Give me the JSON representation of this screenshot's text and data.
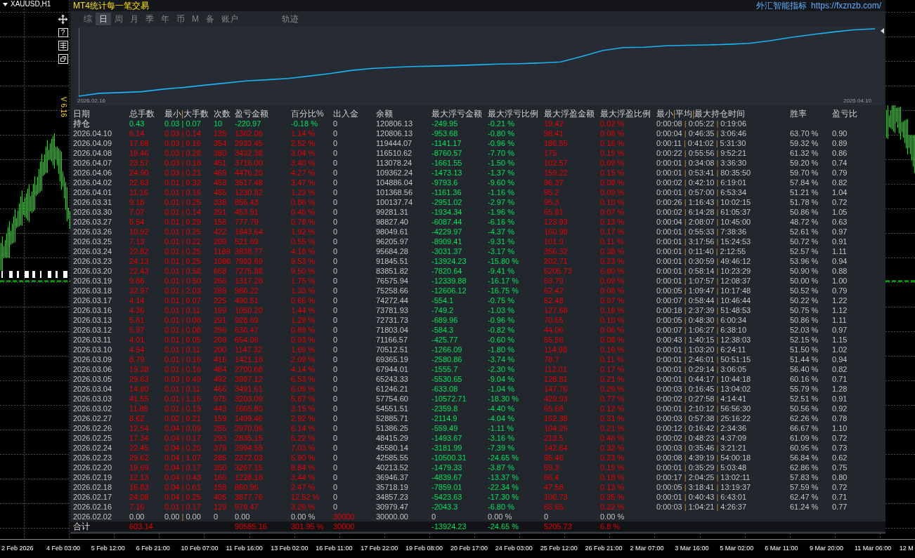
{
  "chart_window": {
    "symbol": "XAUUSD,H1",
    "version": "V 6.16",
    "tools": [
      {
        "kind": "move"
      },
      {
        "kind": "help",
        "label": "?"
      },
      {
        "kind": "table"
      },
      {
        "kind": "window"
      }
    ],
    "time_axis": [
      "2 Feb 2026",
      "4 Feb 03:00",
      "5 Feb 12:00",
      "6 Feb 21:00",
      "10 Feb 07:00",
      "11 Feb 16:00",
      "13 Feb 02:00",
      "16 Feb 11:00",
      "17 Feb 22:00",
      "19 Feb 08:00",
      "20 Feb 17:00",
      "24 Feb 03:00",
      "25 Feb 12:00",
      "26 Feb 21:00",
      "2 Mar 07:00",
      "3 Mar 16:00",
      "5 Mar 02:00",
      "6 Mar 11:00",
      "9 Mar 20:00",
      "11 Mar 06:00",
      "12 M"
    ]
  },
  "panel": {
    "title": "MT4统计每一笔交易",
    "brand": "外汇智能指标",
    "link": "https://fxznzb.com/",
    "tab_groups": [
      [
        {
          "label": "综",
          "selected": false
        },
        {
          "label": "日",
          "selected": true
        },
        {
          "label": "周",
          "selected": false
        },
        {
          "label": "月",
          "selected": false
        },
        {
          "label": "季",
          "selected": false
        },
        {
          "label": "年",
          "selected": false
        },
        {
          "label": "币",
          "selected": false
        },
        {
          "label": "M",
          "selected": false
        },
        {
          "label": "备",
          "selected": false
        },
        {
          "label": "账户",
          "selected": false
        }
      ],
      [
        {
          "label": "轨迹",
          "selected": false
        }
      ]
    ],
    "equity_chart": {
      "start_label": "2026.02.16",
      "end_label": "2026.04.10"
    },
    "table": {
      "columns": [
        "日期",
        "总手数",
        "最小|大手数",
        "次数",
        "盈亏金额",
        "百分比%",
        "出入金",
        "余额",
        "最大浮亏金额",
        "最大浮亏比例",
        "最大浮盈金额",
        "最大浮盈比例",
        "最小|平均|最大持仓时间",
        "胜率",
        "盈亏比"
      ],
      "rows": [
        {
          "kind": "open",
          "loss": true,
          "cells": [
            "持仓",
            "0.43",
            "0.03 | 0.07",
            "10",
            "-220.97",
            "-0.18 %",
            "0",
            "120806.13",
            "-249.95",
            "-0.21 %",
            "19.42",
            "0.02 %",
            "0:00:08 | 0:05:22 | 0:19:06"
          ]
        },
        {
          "kind": "day",
          "loss": false,
          "cells": [
            "2026.04.10",
            "6.14",
            "0.03 | 0.14",
            "135",
            "1362.06",
            "1.14 %",
            "0",
            "120806.13",
            "-953.68",
            "-0.80 %",
            "98.41",
            "0.08 %",
            "0:00:04 | 0:46:35 | 3:06:46",
            "63.70 %",
            "0.90"
          ]
        },
        {
          "kind": "day",
          "loss": false,
          "cells": [
            "2026.04.09",
            "17.68",
            "0.03 | 0.16",
            "354",
            "2933.45",
            "2.52 %",
            "0",
            "119444.07",
            "-1141.17",
            "-0.96 %",
            "186.55",
            "0.16 %",
            "0:00:11 | 0:41:02 | 5:31:30",
            "59.32 %",
            "0.89"
          ]
        },
        {
          "kind": "day",
          "loss": false,
          "cells": [
            "2026.04.08",
            "19.46",
            "0.03 | 0.28",
            "380",
            "3432.38",
            "3.04 %",
            "0",
            "116510.62",
            "-8760.57",
            "-7.70 %",
            "175",
            "0.15 %",
            "0:00:22 | 0:55:56 | 9:52:21",
            "61.32 %",
            "0.86"
          ]
        },
        {
          "kind": "day",
          "loss": false,
          "cells": [
            "2026.04.07",
            "23.57",
            "0.03 | 0.18",
            "451",
            "3716.00",
            "3.40 %",
            "0",
            "113078.24",
            "-1661.55",
            "-1.50 %",
            "102.57",
            "0.09 %",
            "0:00:01 | 0:34:08 | 3:36:30",
            "59.20 %",
            "0.74"
          ]
        },
        {
          "kind": "day",
          "loss": false,
          "cells": [
            "2026.04.06",
            "24.90",
            "0.03 | 0.21",
            "469",
            "4476.20",
            "4.27 %",
            "0",
            "109362.24",
            "-1473.13",
            "-1.37 %",
            "159.22",
            "0.15 %",
            "0:00:01 | 0:53:41 | 80:35:50",
            "59.70 %",
            "0.79"
          ]
        },
        {
          "kind": "day",
          "loss": false,
          "cells": [
            "2026.04.02",
            "22.63",
            "0.01 | 0.32",
            "453",
            "3517.48",
            "3.47 %",
            "0",
            "104886.04",
            "-9793.6",
            "-9.60 %",
            "96.37",
            "0.09 %",
            "0:00:02 | 0:42:10 | 6:19:01",
            "57.84 %",
            "0.82"
          ]
        },
        {
          "kind": "day",
          "loss": false,
          "cells": [
            "2026.04.01",
            "11.16",
            "0.01 | 0.16",
            "455",
            "1230.82",
            "1.23 %",
            "0",
            "101368.56",
            "-1161.36",
            "-1.16 %",
            "95.2",
            "0.09 %",
            "0:00:01 | 0:57:00 | 6:53:34",
            "51.21 %",
            "1.04"
          ]
        },
        {
          "kind": "day",
          "loss": false,
          "cells": [
            "2026.03.31",
            "9.18",
            "0.01 | 0.25",
            "338",
            "856.43",
            "0.86 %",
            "0",
            "100137.74",
            "-2951.02",
            "-2.97 %",
            "95.3",
            "0.10 %",
            "0:00:26 | 1:16:43 | 10:02:15",
            "51.78 %",
            "0.72"
          ]
        },
        {
          "kind": "day",
          "loss": false,
          "cells": [
            "2026.03.30",
            "7.07",
            "0.01 | 0.14",
            "291",
            "453.91",
            "0.46 %",
            "0",
            "99281.31",
            "-1934.34",
            "-1.96 %",
            "65.81",
            "0.07 %",
            "0:00:02 | 6:14:28 | 61:05:37",
            "50.86 %",
            "1.05"
          ]
        },
        {
          "kind": "day",
          "loss": false,
          "cells": [
            "2026.03.27",
            "5.54",
            "0.01 | 0.29",
            "156",
            "777.79",
            "0.79 %",
            "0",
            "98827.40",
            "-6087.44",
            "-6.16 %",
            "123.93",
            "0.13 %",
            "0:00:04 | 2:08:07 | 10:45:00",
            "48.72 %",
            "0.63"
          ]
        },
        {
          "kind": "day",
          "loss": false,
          "cells": [
            "2026.03.26",
            "10.92",
            "0.01 | 0.25",
            "422",
            "1843.64",
            "1.92 %",
            "0",
            "98049.61",
            "-4229.97",
            "-4.37 %",
            "160.98",
            "0.17 %",
            "0:00:01 | 0:55:33 | 7:38:36",
            "52.61 %",
            "0.97"
          ]
        },
        {
          "kind": "day",
          "loss": false,
          "cells": [
            "2026.03.25",
            "7.13",
            "0.01 | 0.22",
            "209",
            "521.69",
            "0.55 %",
            "0",
            "96205.97",
            "-8909.41",
            "-9.31 %",
            "101.9",
            "0.11 %",
            "0:00:01 | 3:17:56 | 15:24:53",
            "50.72 %",
            "0.91"
          ]
        },
        {
          "kind": "day",
          "loss": false,
          "cells": [
            "2026.03.24",
            "22.82",
            "0.01 | 0.25",
            "1189",
            "3838.77",
            "4.18 %",
            "0",
            "95684.28",
            "-3031.37",
            "-3.17 %",
            "356.32",
            "0.38 %",
            "0:00:01 | 0:11:40 | 2:12:55",
            "52.57 %",
            "1.11"
          ]
        },
        {
          "kind": "day",
          "loss": false,
          "cells": [
            "2026.03.23",
            "24.13",
            "0.01 | 0.25",
            "1086",
            "7993.69",
            "9.53 %",
            "0",
            "91845.51",
            "-13924.23",
            "-15.80 %",
            "202.71",
            "0.23 %",
            "0:00:01 | 0:30:59 | 49:46:12",
            "53.96 %",
            "0.94"
          ]
        },
        {
          "kind": "day",
          "loss": false,
          "cells": [
            "2026.03.20",
            "22.43",
            "0.01 | 0.58",
            "668",
            "7275.88",
            "9.50 %",
            "0",
            "83851.82",
            "-7820.64",
            "-9.41 %",
            "5205.73",
            "6.80 %",
            "0:00:01 | 0:58:14 | 10:23:29",
            "50.90 %",
            "0.88"
          ]
        },
        {
          "kind": "day",
          "loss": false,
          "cells": [
            "2026.03.19",
            "9.86",
            "0.01 | 0.50",
            "266",
            "1317.28",
            "1.75 %",
            "0",
            "76575.94",
            "-12339.88",
            "-16.17 %",
            "63.79",
            "0.09 %",
            "0:00:01 | 1:07:57 | 12:08:37",
            "50.00 %",
            "1.00"
          ]
        },
        {
          "kind": "day",
          "loss": false,
          "cells": [
            "2026.03.18",
            "32.97",
            "0.01 | 2.03",
            "289",
            "986.22",
            "1.33 %",
            "0",
            "75258.66",
            "-12606.12",
            "-16.75 %",
            "62.42",
            "0.08 %",
            "0:00:05 | 1:09:47 | 10:17:48",
            "50.52 %",
            "0.79"
          ]
        },
        {
          "kind": "day",
          "loss": false,
          "cells": [
            "2026.03.17",
            "4.14",
            "0.01 | 0.07",
            "225",
            "490.51",
            "0.66 %",
            "0",
            "74272.44",
            "-554.1",
            "-0.75 %",
            "52.48",
            "0.07 %",
            "0:00:07 | 0:58:44 | 10:46:44",
            "50.22 %",
            "1.22"
          ]
        },
        {
          "kind": "day",
          "loss": false,
          "cells": [
            "2026.03.16",
            "4.36",
            "0.01 | 0.11",
            "199",
            "1050.20",
            "1.44 %",
            "0",
            "73781.93",
            "-749.2",
            "-1.03 %",
            "127.68",
            "0.18 %",
            "0:00:18 | 2:37:39 | 51:48:53",
            "50.75 %",
            "1.12"
          ]
        },
        {
          "kind": "day",
          "loss": false,
          "cells": [
            "2026.03.13",
            "5.61",
            "0.01 | 0.08",
            "291",
            "928.69",
            "1.29 %",
            "0",
            "72731.73",
            "-689.96",
            "-0.96 %",
            "70.65",
            "0.10 %",
            "0:00:05 | 0:48:30 | 6:00:34",
            "50.86 %",
            "1.11"
          ]
        },
        {
          "kind": "day",
          "loss": false,
          "cells": [
            "2026.03.12",
            "5.97",
            "0.01 | 0.08",
            "296",
            "636.47",
            "0.89 %",
            "0",
            "71803.04",
            "-584.3",
            "-0.82 %",
            "44.06",
            "0.06 %",
            "0:00:07 | 1:06:27 | 6:38:10",
            "52.03 %",
            "0.97"
          ]
        },
        {
          "kind": "day",
          "loss": false,
          "cells": [
            "2026.03.11",
            "4.01",
            "0.01 | 0.05",
            "209",
            "654.06",
            "0.93 %",
            "0",
            "71166.57",
            "-425.77",
            "-0.60 %",
            "55.56",
            "0.08 %",
            "0:00:43 | 1:40:15 | 12:38:03",
            "52.15 %",
            "1.15"
          ]
        },
        {
          "kind": "day",
          "loss": false,
          "cells": [
            "2026.03.10",
            "4.54",
            "0.01 | 0.11",
            "200",
            "1147.32",
            "1.65 %",
            "0",
            "70512.51",
            "-1266.09",
            "-1.80 %",
            "114.98",
            "0.16 %",
            "0:00:01 | 1:03:20 | 6:24:11",
            "51.50 %",
            "1.02"
          ]
        },
        {
          "kind": "day",
          "loss": false,
          "cells": [
            "2026.03.09",
            "8.79",
            "0.01 | 0.16",
            "416",
            "1421.18",
            "2.09 %",
            "0",
            "69365.19",
            "-2580.86",
            "-3.74 %",
            "78.7",
            "0.11 %",
            "0:00:01 | 2:46:01 | 50:51:15",
            "51.44 %",
            "0.94"
          ]
        },
        {
          "kind": "day",
          "loss": false,
          "cells": [
            "2026.03.06",
            "19.38",
            "0.01 | 0.16",
            "484",
            "2700.68",
            "4.14 %",
            "0",
            "67944.01",
            "-1555.7",
            "-2.30 %",
            "112.01",
            "0.17 %",
            "0:00:01 | 0:29:14 | 3:06:05",
            "56.40 %",
            "0.82"
          ]
        },
        {
          "kind": "day",
          "loss": false,
          "cells": [
            "2026.03.05",
            "29.63",
            "0.03 | 0.49",
            "492",
            "3997.12",
            "6.53 %",
            "0",
            "65243.33",
            "-5530.65",
            "-9.04 %",
            "128.81",
            "0.21 %",
            "0:00:01 | 0:44:17 | 10:44:18",
            "60.16 %",
            "0.71"
          ]
        },
        {
          "kind": "day",
          "loss": false,
          "cells": [
            "2026.03.04",
            "14.80",
            "0.01 | 0.11",
            "466",
            "3491.61",
            "6.05 %",
            "0",
            "61246.21",
            "-633.08",
            "-1.04 %",
            "147.76",
            "0.26 %",
            "0:00:03 | 0:16:45 | 13:04:02",
            "55.79 %",
            "1.28"
          ]
        },
        {
          "kind": "day",
          "loss": false,
          "cells": [
            "2026.03.03",
            "41.55",
            "0.01 | 1.16",
            "975",
            "3203.09",
            "5.87 %",
            "0",
            "57754.60",
            "-10572.71",
            "-18.30 %",
            "429.93",
            "0.77 %",
            "0:00:02 | 0:27:58 | 4:14:41",
            "52.51 %",
            "0.91"
          ]
        },
        {
          "kind": "day",
          "loss": false,
          "cells": [
            "2026.03.02",
            "11.88",
            "0.01 | 0.19",
            "443",
            "1665.80",
            "3.15 %",
            "0",
            "54551.51",
            "-2359.8",
            "-4.40 %",
            "65.68",
            "0.12 %",
            "0:00:01 | 2:10:12 | 56:56:30",
            "50.56 %",
            "0.92"
          ]
        },
        {
          "kind": "day",
          "loss": false,
          "cells": [
            "2026.02.27",
            "8.62",
            "0.02 | 0.21",
            "159",
            "1499.46",
            "2.92 %",
            "0",
            "52885.71",
            "-2114.9",
            "-4.04 %",
            "162.38",
            "0.31 %",
            "0:00:03 | 0:57:38 | 25:16:22",
            "62.26 %",
            "0.78"
          ]
        },
        {
          "kind": "day",
          "loss": false,
          "cells": [
            "2026.02.26",
            "12.54",
            "0.04 | 0.09",
            "255",
            "2970.96",
            "6.14 %",
            "0",
            "51386.25",
            "-559.49",
            "-1.11 %",
            "104.26",
            "0.21 %",
            "0:00:12 | 0:16:42 | 2:34:36",
            "66.67 %",
            "1.10"
          ]
        },
        {
          "kind": "day",
          "loss": false,
          "cells": [
            "2026.02.25",
            "17.34",
            "0.04 | 0.17",
            "293",
            "2835.15",
            "6.22 %",
            "0",
            "48415.29",
            "-1493.67",
            "-3.16 %",
            "213.5",
            "0.46 %",
            "0:00:02 | 0:48:23 | 4:37:09",
            "61.09 %",
            "0.72"
          ]
        },
        {
          "kind": "day",
          "loss": false,
          "cells": [
            "2026.02.24",
            "22.45",
            "0.04 | 0.20",
            "379",
            "2994.59",
            "7.03 %",
            "0",
            "45580.14",
            "-3181.99",
            "-7.39 %",
            "142.64",
            "0.32 %",
            "0:00:03 | 0:35:46 | 3:21:21",
            "60.95 %",
            "0.73"
          ]
        },
        {
          "kind": "day",
          "loss": false,
          "cells": [
            "2026.02.23",
            "29.62",
            "0.04 | 1.07",
            "285",
            "2372.03",
            "5.90 %",
            "0",
            "42585.55",
            "-10500.31",
            "-24.65 %",
            "95.46",
            "0.23 %",
            "0:00:08 | 4:39:19 | 54:00:18",
            "56.84 %",
            "0.62"
          ]
        },
        {
          "kind": "day",
          "loss": false,
          "cells": [
            "2026.02.20",
            "19.69",
            "0.04 | 0.17",
            "350",
            "3267.15",
            "8.84 %",
            "0",
            "40213.52",
            "-1479.33",
            "-3.87 %",
            "59.3",
            "0.15 %",
            "0:00:01 | 0:35:29 | 5:03:48",
            "62.86 %",
            "0.75"
          ]
        },
        {
          "kind": "day",
          "loss": false,
          "cells": [
            "2026.02.19",
            "12.13",
            "0.04 | 0.43",
            "166",
            "1228.18",
            "3.44 %",
            "0",
            "36946.37",
            "-4839.67",
            "-13.37 %",
            "66.4",
            "0.18 %",
            "0:00:17 | 2:04:25 | 13:02:11",
            "57.83 %",
            "0.80"
          ]
        },
        {
          "kind": "day",
          "loss": false,
          "cells": [
            "2026.02.18",
            "16.83",
            "0.04 | 0.61",
            "158",
            "860.96",
            "2.47 %",
            "0",
            "35718.19",
            "-7859.01",
            "-22.34 %",
            "47.58",
            "0.13 %",
            "0:00:05 | 3:18:41 | 13:19:37",
            "57.59 %",
            "0.72"
          ]
        },
        {
          "kind": "day",
          "loss": false,
          "cells": [
            "2026.02.17",
            "24.08",
            "0.04 | 0.25",
            "405",
            "3877.76",
            "12.52 %",
            "0",
            "34857.23",
            "-5423.63",
            "-17.30 %",
            "106.73",
            "0.35 %",
            "0:00:01 | 0:40:43 | 6:43:01",
            "62.47 %",
            "0.71"
          ]
        },
        {
          "kind": "day",
          "loss": false,
          "cells": [
            "2026.02.16",
            "7.16",
            "0.01 | 0.17",
            "129",
            "979.47",
            "3.26 %",
            "0",
            "30979.47",
            "-2043.3",
            "-6.80 %",
            "65.65",
            "0.22 %",
            "0:00:03 | 1:04:21 | 4:26:37",
            "61.24 %",
            "0.77"
          ]
        },
        {
          "kind": "funding",
          "loss": false,
          "cells": [
            "2026.02.02",
            "0.00",
            "0.00 | 0.00",
            "0",
            "0.00",
            "0.00 %",
            "30000",
            "30000.00",
            "0",
            "0.00 %",
            "0",
            "0.00 %"
          ]
        }
      ],
      "totals": {
        "loss": false,
        "label": "合计",
        "lots": "603.14",
        "profit": "90585.16",
        "percent": "301.95 %",
        "funds": "30000",
        "max_float_loss": "-13924.23",
        "max_float_loss_pct": "-24.65 %",
        "max_float_gain": "5205.73",
        "max_float_gain_pct": "6.8 %"
      }
    }
  }
}
